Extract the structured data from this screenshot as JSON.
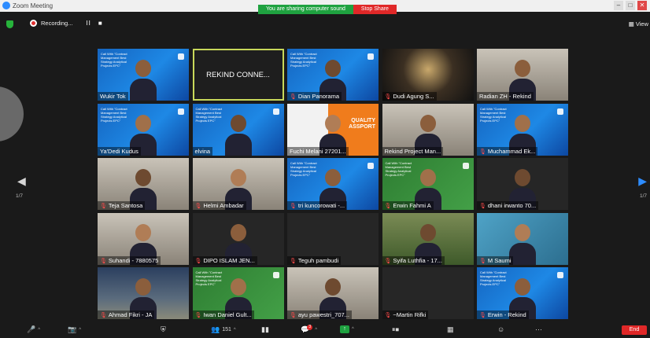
{
  "window": {
    "title": "Zoom Meeting"
  },
  "share_banner": {
    "message": "You are sharing computer sound",
    "stop_label": "Stop Share"
  },
  "topbar": {
    "recording_label": "Recording...",
    "pause_label": "II",
    "stop_label": "■",
    "view_label": "View"
  },
  "pagination": {
    "left_label": "1/7",
    "right_label": "1/7"
  },
  "participants": [
    {
      "name": "Wukir Tok",
      "bg": "blue",
      "muted": false
    },
    {
      "name": "REKIND CONNE...",
      "bg": "active",
      "muted": false
    },
    {
      "name": "Dian Panorama",
      "bg": "blue",
      "muted": true
    },
    {
      "name": "Dudi Agung S...",
      "bg": "night",
      "muted": true
    },
    {
      "name": "Radian ZH - Rekind",
      "bg": "office",
      "muted": false
    },
    {
      "name": "Ya'Dedi Kudus",
      "bg": "blue",
      "muted": false
    },
    {
      "name": "elvina",
      "bg": "blue",
      "muted": false
    },
    {
      "name": "Fuchi Melani 27201...",
      "bg": "orange",
      "muted": false
    },
    {
      "name": "Rekind Project Man...",
      "bg": "office",
      "muted": false
    },
    {
      "name": "Muchammad Ek...",
      "bg": "blue",
      "muted": true
    },
    {
      "name": "Teja Santosa",
      "bg": "office",
      "muted": true
    },
    {
      "name": "Helmi Ambadar",
      "bg": "office",
      "muted": true
    },
    {
      "name": "tri kuncorowati -...",
      "bg": "blue",
      "muted": true
    },
    {
      "name": "Erwin Fahmi A",
      "bg": "green",
      "muted": true
    },
    {
      "name": "dhani irwanto 70...",
      "bg": "dark",
      "muted": true
    },
    {
      "name": "Suhandi - 7880575",
      "bg": "office",
      "muted": true
    },
    {
      "name": "DIPO ISLAM JEN...",
      "bg": "dark",
      "muted": true
    },
    {
      "name": "Teguh pambudi",
      "bg": "dark",
      "muted": true
    },
    {
      "name": "Syifa Luthfia - 17...",
      "bg": "forest",
      "muted": true
    },
    {
      "name": "M Saumi",
      "bg": "teal",
      "muted": true
    },
    {
      "name": "Ahmad Fikri - JA",
      "bg": "mecca",
      "muted": true
    },
    {
      "name": "Iwan Daniel Gult...",
      "bg": "green",
      "muted": true
    },
    {
      "name": "ayu pawestri_707...",
      "bg": "office",
      "muted": true
    },
    {
      "name": "~Martin Rifki",
      "bg": "dark",
      "muted": true
    },
    {
      "name": "Erwin - Rekind",
      "bg": "blue",
      "muted": true
    }
  ],
  "tile_banner": {
    "text": "Call With \"Contract Management Best Strategy Analytical Projects EPC\""
  },
  "tile_quality": {
    "line1": "QUALITY",
    "line2": "ASSPORT"
  },
  "toolbar": {
    "participants_count": "151",
    "chat_badge": "3",
    "end_label": "End"
  },
  "colors": {
    "accent": "#2d8cff",
    "active_speaker_border": "#c8d85a",
    "share_green": "#1fa240",
    "stop_red": "#e02828"
  }
}
